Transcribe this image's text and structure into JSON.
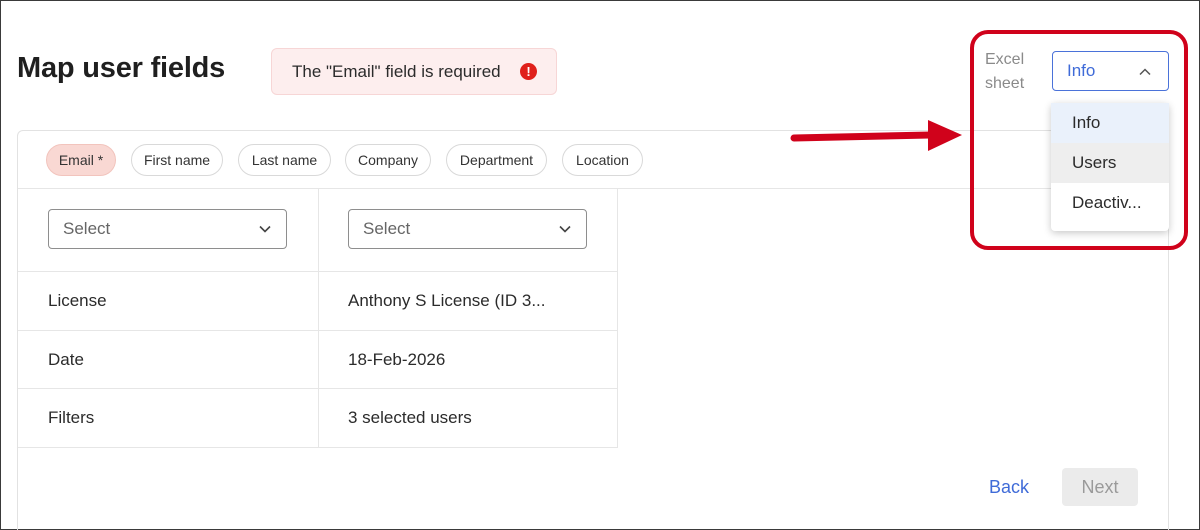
{
  "page": {
    "title": "Map user fields"
  },
  "error_banner": {
    "message": "The \"Email\" field is required",
    "icon": "!"
  },
  "field_chips": [
    {
      "label": "Email *",
      "required": true
    },
    {
      "label": "First name",
      "required": false
    },
    {
      "label": "Last name",
      "required": false
    },
    {
      "label": "Company",
      "required": false
    },
    {
      "label": "Department",
      "required": false
    },
    {
      "label": "Location",
      "required": false
    }
  ],
  "columns": [
    {
      "select_placeholder": "Select"
    },
    {
      "select_placeholder": "Select"
    }
  ],
  "rows": [
    {
      "key": "License",
      "value": "Anthony S License (ID 3..."
    },
    {
      "key": "Date",
      "value": "18-Feb-2026"
    },
    {
      "key": "Filters",
      "value": "3 selected users"
    }
  ],
  "footer": {
    "back_label": "Back",
    "next_label": "Next"
  },
  "excel_sheet": {
    "label": "Excel sheet",
    "selected": "Info",
    "options": [
      "Info",
      "Users",
      "Deactiv..."
    ]
  },
  "colors": {
    "accent": "#3f6bd8",
    "error": "#e0201b",
    "annotation": "#d0021b",
    "required_chip": "#f9d8d3"
  }
}
